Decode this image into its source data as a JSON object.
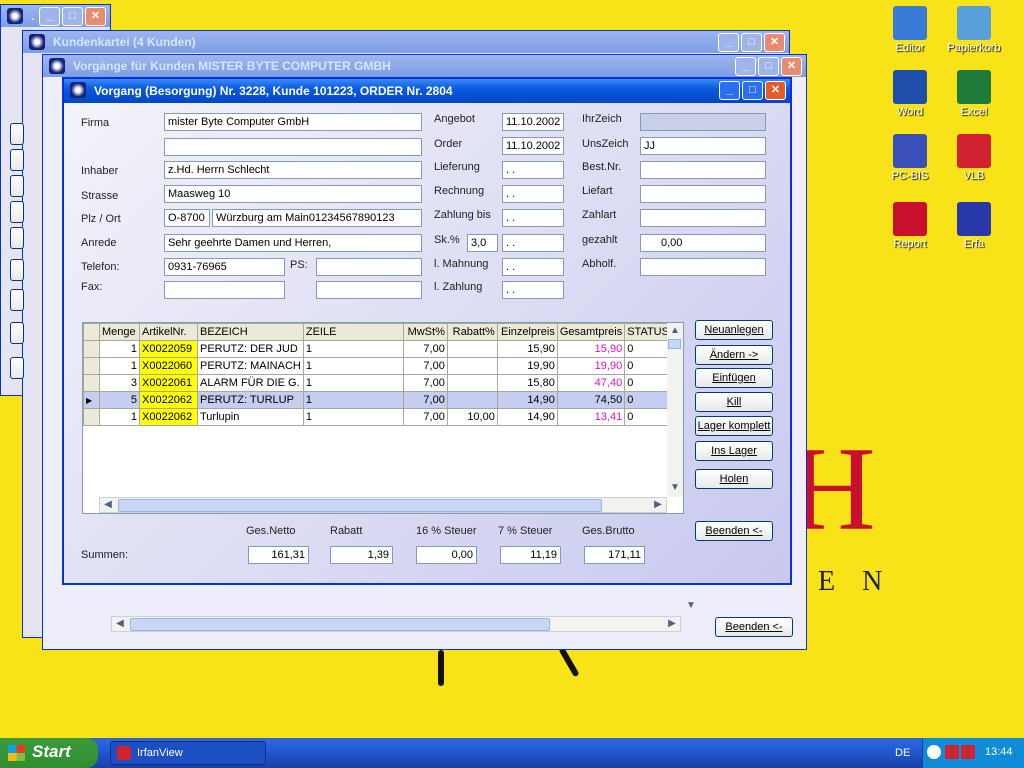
{
  "desktop": {
    "icons": [
      {
        "label": "Editor",
        "icon": "editor-icon",
        "color": "#3a7bd5"
      },
      {
        "label": "Papierkorb",
        "icon": "recycle-bin-icon",
        "color": "#5aa0d8"
      },
      {
        "label": "Word",
        "icon": "word-icon",
        "color": "#1e4fa8"
      },
      {
        "label": "Excel",
        "icon": "excel-icon",
        "color": "#1e7b3a"
      },
      {
        "label": "PC-BIS",
        "icon": "pc-bis-icon",
        "color": "#3b4fb8"
      },
      {
        "label": "VLB",
        "icon": "vlb-icon",
        "color": "#d0232f"
      },
      {
        "label": "Report",
        "icon": "report-icon",
        "color": "#c8102e"
      },
      {
        "label": "Erfa",
        "icon": "erfa-icon",
        "color": "#2838a8"
      }
    ]
  },
  "windows": {
    "kundenkartei": {
      "title": "Kundenkartei    (4 Kunden)"
    },
    "vorgaenge": {
      "title": "Vorgänge für Kunden   MISTER BYTE COMPUTER GMBH",
      "close_label": "Beenden <-"
    },
    "back_dot": {
      "title": "."
    },
    "main": {
      "title": "Vorgang (Besorgung) Nr. 3228, Kunde 101223,  ORDER Nr. 2804"
    }
  },
  "form": {
    "firma_label": "Firma",
    "firma": "mister Byte Computer GmbH",
    "firma2": "",
    "inhaber_label": "Inhaber",
    "inhaber": "z.Hd. Herrn Schlecht",
    "strasse_label": "Strasse",
    "strasse": "Maasweg 10",
    "plz_label": "Plz / Ort",
    "plz": "O-8700",
    "ort": "Würzburg am Main01234567890123",
    "anrede_label": "Anrede",
    "anrede": "Sehr geehrte Damen und Herren,",
    "telefon_label": "Telefon:",
    "telefon": "0931-76965",
    "ps_label": "PS:",
    "ps": "",
    "fax_label": "Fax:",
    "fax": "",
    "fax2": "",
    "angebot_label": "Angebot",
    "angebot": "11.10.2002",
    "order_label": "Order",
    "order": "11.10.2002",
    "lieferung_label": "Lieferung",
    "lieferung": " .  .",
    "rechnung_label": "Rechnung",
    "rechnung": " .  .",
    "zahlung_bis_label": "Zahlung bis",
    "zahlung_bis": " .  .",
    "sk_label": "Sk.%",
    "sk": "3,0",
    "sk_date": " .  .",
    "mahnung_label": "l. Mahnung",
    "mahnung": " .  .",
    "l_zahlung_label": "l. Zahlung",
    "l_zahlung": " .  .",
    "ihrzeich_label": "IhrZeich",
    "ihrzeich": "",
    "unszeich_label": "UnsZeich",
    "unszeich": "JJ",
    "bestnr_label": "Best.Nr.",
    "bestnr": "",
    "liefart_label": "Liefart",
    "liefart": "",
    "zahlart_label": "Zahlart",
    "zahlart": "",
    "gezahlt_label": "gezahlt",
    "gezahlt": "0,00",
    "abholf_label": "Abholf.",
    "abholf": ""
  },
  "grid": {
    "columns": [
      "",
      "Menge",
      "ArtikelNr.",
      "BEZEICH",
      "ZEILE",
      "MwSt%",
      "Rabatt%",
      "Einzelpreis",
      "Gesamtpreis",
      "STATUS"
    ],
    "rows": [
      {
        "menge": "1",
        "art": "X0022059",
        "bez": "PERUTZ: DER JUD",
        "zeile": "1",
        "mwst": "7,00",
        "rabatt": "",
        "einzel": "15,90",
        "gesamt": "15,90",
        "status": "0",
        "pink": true,
        "sel": false
      },
      {
        "menge": "1",
        "art": "X0022060",
        "bez": "PERUTZ: MAINACH",
        "zeile": "1",
        "mwst": "7,00",
        "rabatt": "",
        "einzel": "19,90",
        "gesamt": "19,90",
        "status": "0",
        "pink": true,
        "sel": false
      },
      {
        "menge": "3",
        "art": "X0022061",
        "bez": "ALARM FÜR DIE G.",
        "zeile": "1",
        "mwst": "7,00",
        "rabatt": "",
        "einzel": "15,80",
        "gesamt": "47,40",
        "status": "0",
        "pink": true,
        "sel": false
      },
      {
        "menge": "5",
        "art": "X0022062",
        "bez": "PERUTZ: TURLUP",
        "zeile": "1",
        "mwst": "7,00",
        "rabatt": "",
        "einzel": "14,90",
        "gesamt": "74,50",
        "status": "0",
        "pink": false,
        "sel": true
      },
      {
        "menge": "1",
        "art": "X0022062",
        "bez": "Turlupin",
        "zeile": "1",
        "mwst": "7,00",
        "rabatt": "10,00",
        "einzel": "14,90",
        "gesamt": "13,41",
        "status": "0",
        "pink": true,
        "sel": false
      }
    ]
  },
  "buttons": {
    "neuanlegen": "Neuanlegen",
    "aendern": "Ändern ->",
    "einfuegen": "Einfügen",
    "kill": "Kill",
    "lager_komplett": "Lager komplett",
    "ins_lager": "Ins Lager",
    "holen": "Holen",
    "beenden": "Beenden <-"
  },
  "summen": {
    "label": "Summen:",
    "netto_label": "Ges.Netto",
    "netto": "161,31",
    "rabatt_label": "Rabatt",
    "rabatt": "1,39",
    "steuer16_label": "16 % Steuer",
    "steuer16": "0,00",
    "steuer7_label": "7 % Steuer",
    "steuer7": "11,19",
    "brutto_label": "Ges.Brutto",
    "brutto": "171,11"
  },
  "taskbar": {
    "start": "Start",
    "task": "IrfanView",
    "lang": "DE",
    "clock": "13:44"
  }
}
